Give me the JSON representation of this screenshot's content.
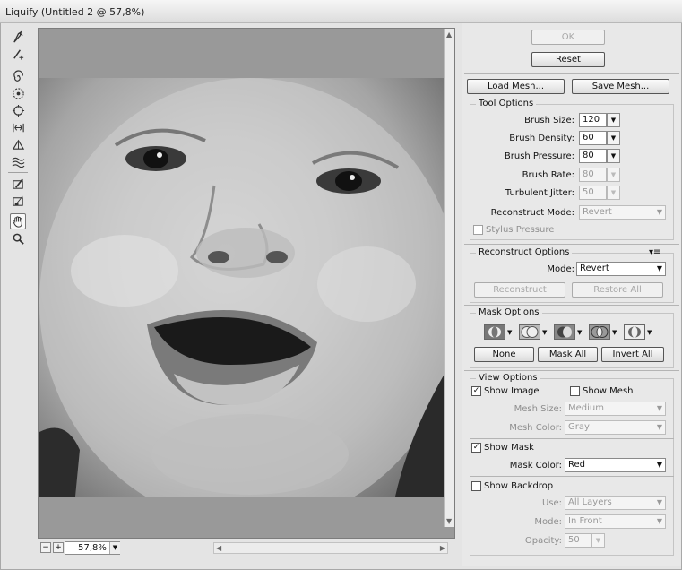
{
  "window": {
    "title": "Liquify (Untitled 2 @ 57,8%)"
  },
  "tools": [
    "forward-warp-tool",
    "reconstruct-tool",
    "twirl-tool",
    "pucker-tool",
    "bloat-tool",
    "push-left-tool",
    "mirror-tool",
    "turbulence-tool",
    "freeze-mask-tool",
    "thaw-mask-tool",
    "hand-tool",
    "zoom-tool"
  ],
  "canvas": {
    "zoom": "57,8%"
  },
  "buttons": {
    "ok": "OK",
    "reset": "Reset",
    "load_mesh": "Load Mesh...",
    "save_mesh": "Save Mesh..."
  },
  "tool_options": {
    "title": "Tool Options",
    "brush_size_label": "Brush Size:",
    "brush_size": "120",
    "brush_density_label": "Brush Density:",
    "brush_density": "60",
    "brush_pressure_label": "Brush Pressure:",
    "brush_pressure": "80",
    "brush_rate_label": "Brush Rate:",
    "brush_rate": "80",
    "turbulent_jitter_label": "Turbulent Jitter:",
    "turbulent_jitter": "50",
    "reconstruct_mode_label": "Reconstruct Mode:",
    "reconstruct_mode": "Revert",
    "stylus_pressure": "Stylus Pressure"
  },
  "reconstruct_options": {
    "title": "Reconstruct Options",
    "mode_label": "Mode:",
    "mode": "Revert",
    "reconstruct": "Reconstruct",
    "restore_all": "Restore All"
  },
  "mask_options": {
    "title": "Mask Options",
    "none": "None",
    "mask_all": "Mask All",
    "invert_all": "Invert All"
  },
  "view_options": {
    "title": "View Options",
    "show_image": "Show Image",
    "show_mesh": "Show Mesh",
    "mesh_size_label": "Mesh Size:",
    "mesh_size": "Medium",
    "mesh_color_label": "Mesh Color:",
    "mesh_color": "Gray",
    "show_mask": "Show Mask",
    "mask_color_label": "Mask Color:",
    "mask_color": "Red",
    "show_backdrop": "Show Backdrop",
    "use_label": "Use:",
    "use": "All Layers",
    "mode_label": "Mode:",
    "mode": "In Front",
    "opacity_label": "Opacity:",
    "opacity": "50"
  }
}
